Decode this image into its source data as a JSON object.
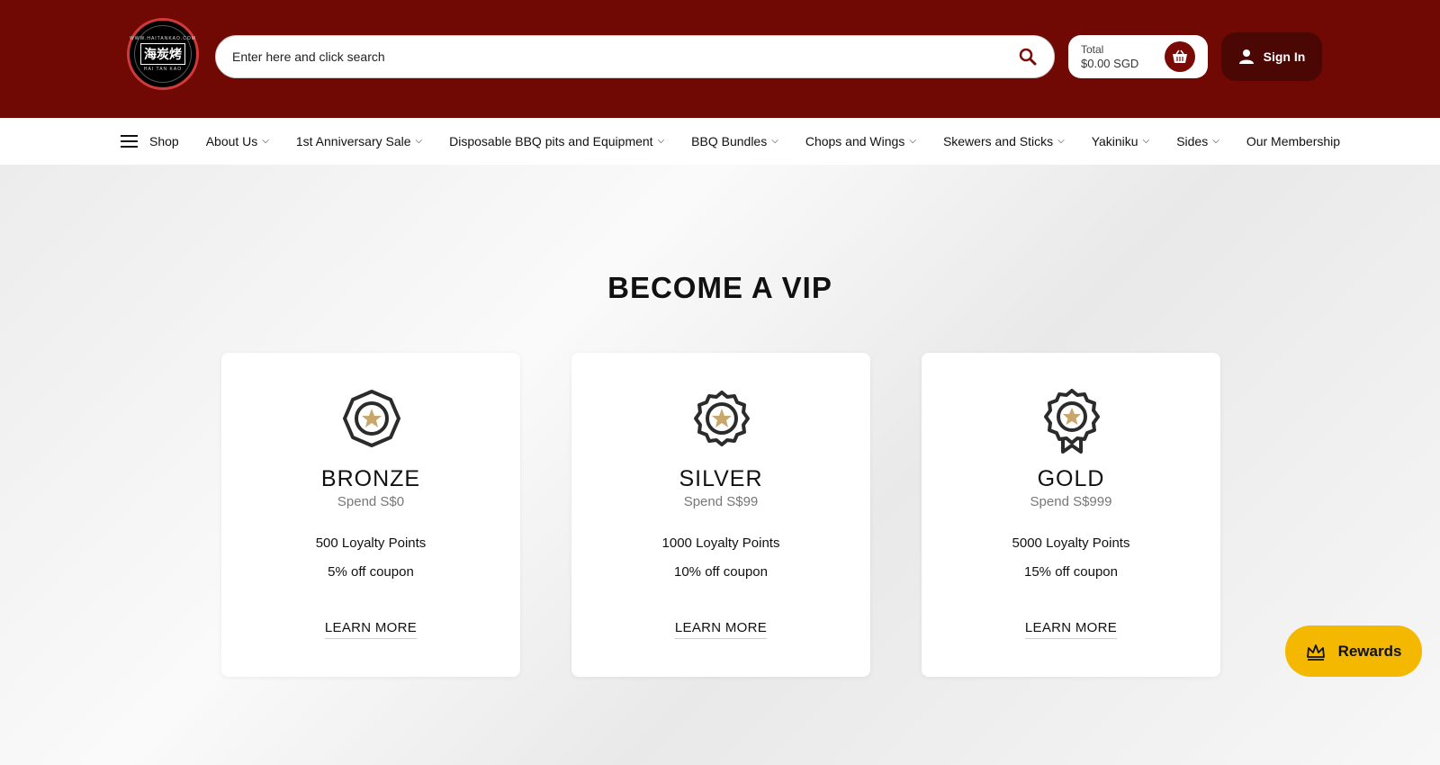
{
  "header": {
    "logo": {
      "top_text": "WWW.HAITANKAO.COM",
      "main_text": "海炭烤",
      "sub_text": "HAI TAN KAO"
    },
    "search": {
      "placeholder": "Enter here and click search",
      "icon": "search-icon"
    },
    "cart": {
      "total_label": "Total",
      "amount": "$0.00 SGD",
      "icon": "basket-icon"
    },
    "signin": {
      "label": "Sign In",
      "icon": "user-icon"
    },
    "colors": {
      "header_bg": "#700903",
      "cart_button": "#7a0a05",
      "signin_bg": "#4a0704"
    }
  },
  "nav": {
    "shop_label": "Shop",
    "items": [
      {
        "label": "About Us"
      },
      {
        "label": "1st Anniversary Sale"
      },
      {
        "label": "Disposable BBQ pits and Equipment"
      },
      {
        "label": "BBQ Bundles"
      },
      {
        "label": "Chops and Wings"
      },
      {
        "label": "Skewers and Sticks"
      },
      {
        "label": "Yakiniku"
      },
      {
        "label": "Sides"
      }
    ],
    "membership_label": "Our Membership"
  },
  "main": {
    "title": "BECOME A VIP",
    "tiers": [
      {
        "name": "BRONZE",
        "spend": "Spend S$0",
        "points": "500 Loyalty Points",
        "coupon": "5% off coupon",
        "cta": "LEARN MORE",
        "icon": "bronze-badge-icon"
      },
      {
        "name": "SILVER",
        "spend": "Spend S$99",
        "points": "1000 Loyalty Points",
        "coupon": "10% off coupon",
        "cta": "LEARN MORE",
        "icon": "silver-badge-icon"
      },
      {
        "name": "GOLD",
        "spend": "Spend S$999",
        "points": "5000 Loyalty Points",
        "coupon": "15% off coupon",
        "cta": "LEARN MORE",
        "icon": "gold-badge-icon"
      }
    ],
    "badge_colors": {
      "outline": "#2b2b2b",
      "star": "#c9a66b"
    }
  },
  "rewards": {
    "label": "Rewards",
    "icon": "crown-icon",
    "color": "#f5b800"
  }
}
